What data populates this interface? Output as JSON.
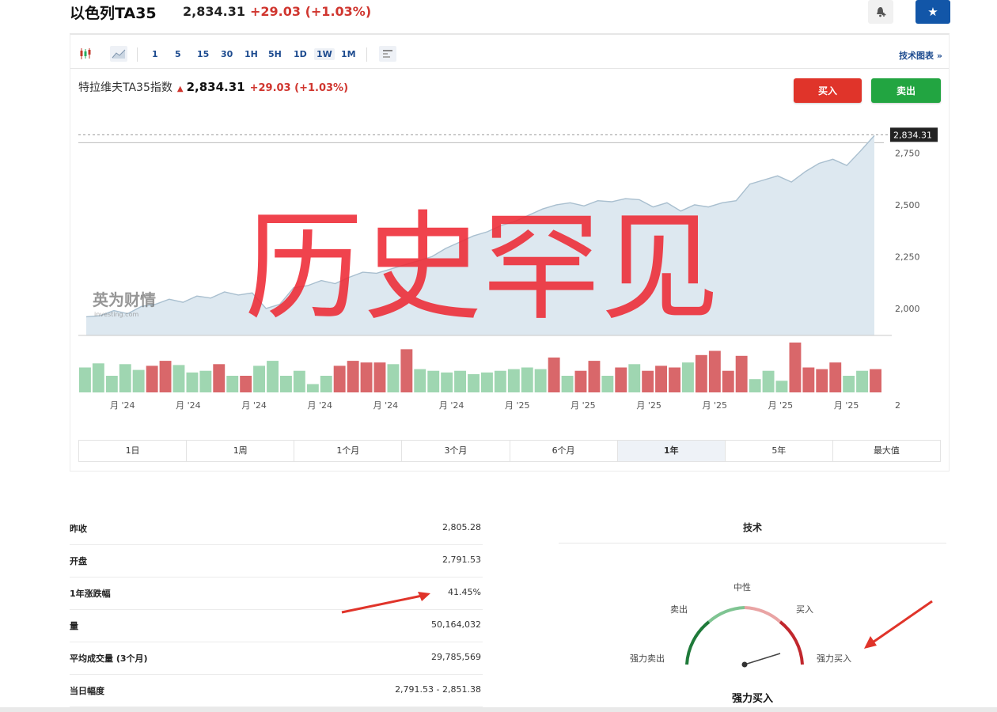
{
  "header": {
    "title": "以色列TA35",
    "price": "2,834.31",
    "change": "+29.03 (+1.03%)"
  },
  "toolbar": {
    "timeframes": [
      "1",
      "5",
      "15",
      "30",
      "1H",
      "5H",
      "1D",
      "1W",
      "1M"
    ],
    "active_timeframe": "1W",
    "tech_chart_link": "技术图表 »"
  },
  "quote": {
    "name": "特拉维夫TA35指数",
    "price": "2,834.31",
    "change": "+29.03 (+1.03%)"
  },
  "actions": {
    "buy": "买入",
    "sell": "卖出"
  },
  "overlay": {
    "text": "历史罕见",
    "watermark": "英为财情",
    "watermark_sub": "investing.com"
  },
  "chart_data": {
    "type": "area",
    "current_value_label": "2,834.31",
    "y_ticks": [
      "2,750",
      "2,500",
      "2,250",
      "2,000"
    ],
    "x_tick_labels": [
      "月 '24",
      "月 '24",
      "月 '24",
      "月 '24",
      "月 '24",
      "月 '24",
      "月 '25",
      "月 '25",
      "月 '25",
      "月 '25",
      "月 '25",
      "月 '25",
      "2"
    ],
    "y": [
      1960,
      1965,
      1990,
      1975,
      2010,
      2020,
      2045,
      2030,
      2060,
      2050,
      2080,
      2065,
      2075,
      2000,
      2020,
      2100,
      2110,
      2135,
      2120,
      2150,
      2175,
      2170,
      2190,
      2210,
      2230,
      2250,
      2290,
      2320,
      2350,
      2370,
      2400,
      2420,
      2450,
      2480,
      2500,
      2510,
      2495,
      2520,
      2515,
      2530,
      2525,
      2490,
      2510,
      2470,
      2500,
      2490,
      2510,
      2520,
      2600,
      2620,
      2640,
      2610,
      2660,
      2700,
      2720,
      2690,
      2760,
      2834.31
    ],
    "volume": {
      "values": [
        30,
        35,
        20,
        34,
        27,
        32,
        38,
        33,
        24,
        26,
        34,
        20,
        20,
        32,
        38,
        20,
        26,
        10,
        20,
        32,
        38,
        36,
        36,
        34,
        52,
        28,
        26,
        24,
        26,
        22,
        24,
        26,
        28,
        30,
        28,
        42,
        20,
        26,
        38,
        20,
        30,
        34,
        26,
        32,
        30,
        36,
        45,
        50,
        26,
        44,
        16,
        26,
        14,
        60,
        30,
        28,
        36,
        20,
        26,
        28
      ]
    }
  },
  "ranges": {
    "items": [
      "1日",
      "1周",
      "1个月",
      "3个月",
      "6个月",
      "1年",
      "5年",
      "最大值"
    ],
    "active": "1年"
  },
  "stats": {
    "rows": [
      {
        "label": "昨收",
        "value": "2,805.28"
      },
      {
        "label": "开盘",
        "value": "2,791.53"
      },
      {
        "label": "1年涨跌幅",
        "value": "41.45%"
      },
      {
        "label": "量",
        "value": "50,164,032"
      },
      {
        "label": "平均成交量 (3个月)",
        "value": "29,785,569"
      },
      {
        "label": "当日幅度",
        "value": "2,791.53 - 2,851.38"
      }
    ]
  },
  "technical": {
    "title": "技术",
    "labels": {
      "neutral": "中性",
      "sell": "卖出",
      "buy": "买入",
      "strong_sell": "强力卖出",
      "strong_buy": "强力买入"
    },
    "summary": "强力买入"
  },
  "colors": {
    "up": "#d0362f",
    "buy": "#e0342a",
    "sell": "#22a541",
    "vol_up": "#9fd6b1",
    "vol_down": "#d9676a",
    "area": "#dde8f0",
    "line": "#a9bfcf",
    "overlay": "#ee2a35",
    "arrow": "#e0342a"
  }
}
